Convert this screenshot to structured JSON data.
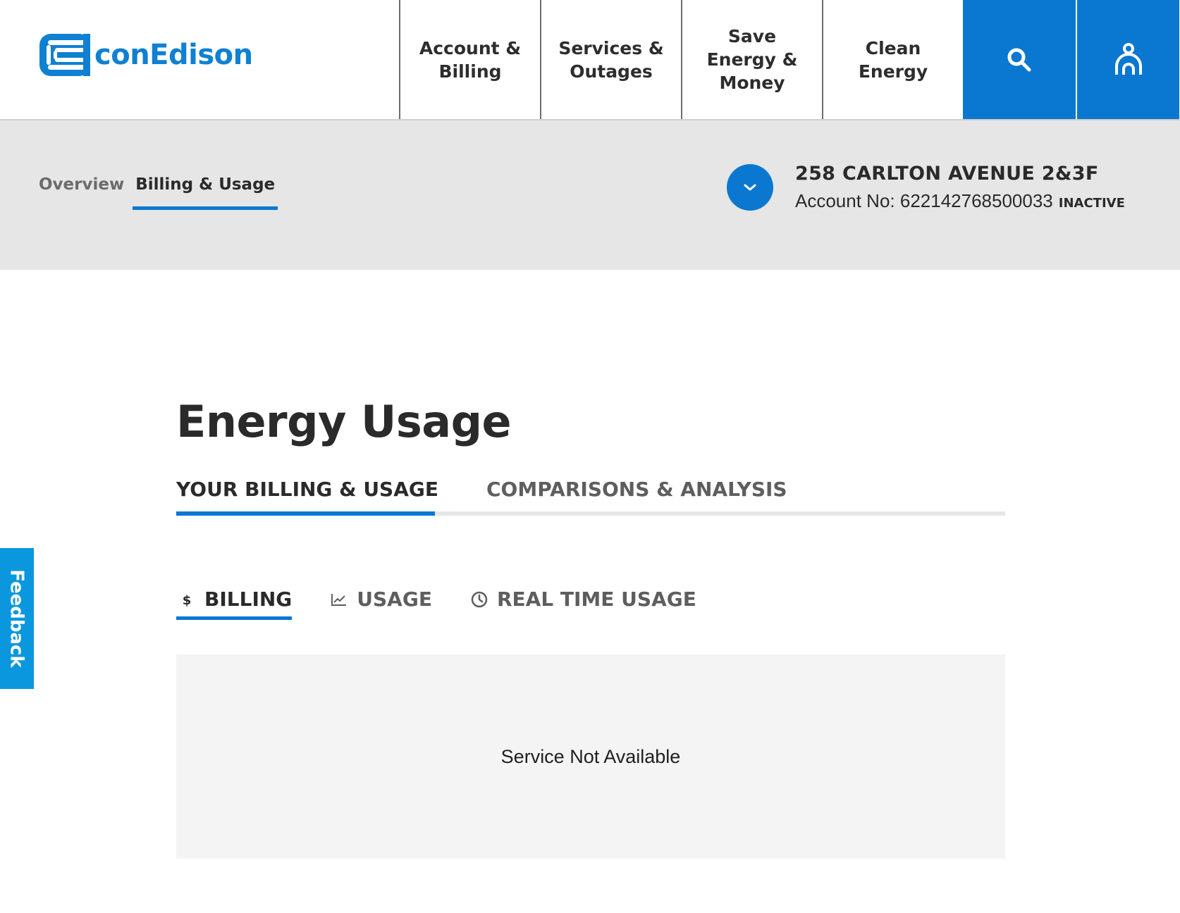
{
  "brand": {
    "name": "conEdison",
    "color": "#0a78d1"
  },
  "nav": {
    "items": [
      {
        "label": "Account & Billing"
      },
      {
        "label": "Services & Outages"
      },
      {
        "label": "Save Energy & Money"
      },
      {
        "label": "Clean Energy"
      }
    ],
    "search_icon": "search-icon",
    "user_icon": "user-icon"
  },
  "subheader": {
    "tabs": [
      {
        "label": "Overview",
        "active": false
      },
      {
        "label": "Billing & Usage",
        "active": true
      }
    ],
    "account": {
      "address": "258 CARLTON AVENUE 2&3F",
      "number_line": "Account No: 622142768500033",
      "status": "INACTIVE"
    }
  },
  "main": {
    "title": "Energy Usage",
    "tabs": [
      {
        "label": "YOUR BILLING & USAGE",
        "active": true
      },
      {
        "label": "COMPARISONS & ANALYSIS",
        "active": false
      }
    ],
    "subtabs": [
      {
        "label": "BILLING",
        "icon": "dollar-icon",
        "active": true
      },
      {
        "label": "USAGE",
        "icon": "trend-chart-icon",
        "active": false
      },
      {
        "label": "REAL TIME USAGE",
        "icon": "clock-icon",
        "active": false
      }
    ],
    "panel_message": "Service Not Available"
  },
  "feedback": {
    "label": "Feedback"
  }
}
